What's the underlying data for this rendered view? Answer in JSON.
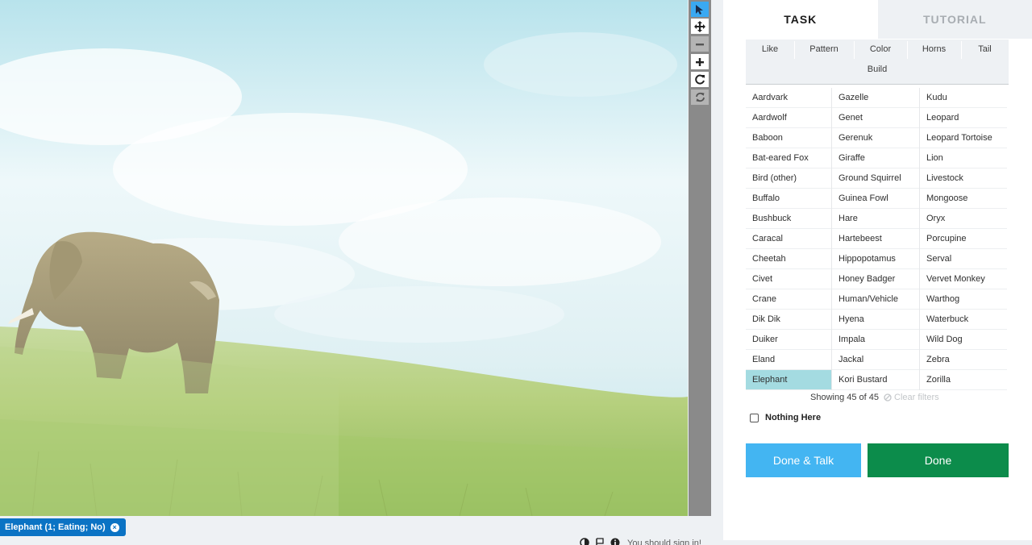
{
  "tabs": {
    "task": "TASK",
    "tutorial": "TUTORIAL"
  },
  "filters": [
    "Like",
    "Pattern",
    "Color",
    "Horns",
    "Tail",
    "Build"
  ],
  "species_columns": [
    [
      "Aardvark",
      "Aardwolf",
      "Baboon",
      "Bat-eared Fox",
      "Bird (other)",
      "Buffalo",
      "Bushbuck",
      "Caracal",
      "Cheetah",
      "Civet",
      "Crane",
      "Dik Dik",
      "Duiker",
      "Eland",
      "Elephant"
    ],
    [
      "Gazelle",
      "Genet",
      "Gerenuk",
      "Giraffe",
      "Ground Squirrel",
      "Guinea Fowl",
      "Hare",
      "Hartebeest",
      "Hippopotamus",
      "Honey Badger",
      "Human/Vehicle",
      "Hyena",
      "Impala",
      "Jackal",
      "Kori Bustard"
    ],
    [
      "Kudu",
      "Leopard",
      "Leopard Tortoise",
      "Lion",
      "Livestock",
      "Mongoose",
      "Oryx",
      "Porcupine",
      "Serval",
      "Vervet Monkey",
      "Warthog",
      "Waterbuck",
      "Wild Dog",
      "Zebra",
      "Zorilla"
    ]
  ],
  "selected_species": "Elephant",
  "showing_text": "Showing 45 of 45",
  "clear_filters": "Clear filters",
  "nothing_here": "Nothing Here",
  "buttons": {
    "done_talk": "Done & Talk",
    "done": "Done"
  },
  "annotation_tag": {
    "label": "Elephant (1; Eating; No)",
    "remove": "×"
  },
  "signin_note": "You should sign in!",
  "toolbar": [
    "pointer-tool",
    "pan-tool",
    "zoom-out-tool",
    "zoom-in-tool",
    "rotate-tool",
    "reset-tool"
  ],
  "colors": {
    "accent_blue": "#43b5f2",
    "done_green": "#0c8c4b",
    "selected_species": "#a4dbe1",
    "tag_blue": "#0b73c4",
    "active_tool": "#3aa9f2"
  }
}
